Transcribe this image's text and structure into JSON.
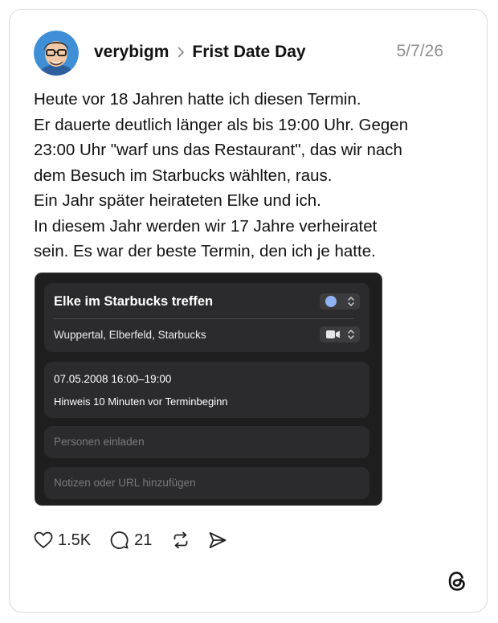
{
  "post": {
    "author": "verybigm",
    "topic": "Frist Date Day",
    "date": "5/7/26",
    "body_lines": [
      "Heute vor 18 Jahren hatte ich diesen Termin.",
      "Er dauerte deutlich länger als bis 19:00 Uhr. Gegen",
      "23:00 Uhr \"warf uns das Restaurant\", das wir nach",
      "dem Besuch im Starbucks wählten, raus.",
      "Ein Jahr später heirateten Elke und ich.",
      "In diesem Jahr werden wir 17 Jahre verheiratet",
      "sein. Es war der beste Termin, den ich je hatte."
    ]
  },
  "event": {
    "title": "Elke im Starbucks treffen",
    "location": "Wuppertal, Elberfeld, Starbucks",
    "datetime": "07.05.2008  16:00–19:00",
    "alert": "Hinweis 10 Minuten vor Terminbeginn",
    "invite_placeholder": "Personen einladen",
    "notes_placeholder": "Notizen oder URL hinzufügen",
    "calendar_color": "#8fb3f2"
  },
  "actions": {
    "likes": "1.5K",
    "replies": "21"
  },
  "icons": {
    "like": "heart-icon",
    "reply": "speech-bubble-icon",
    "repost": "repost-icon",
    "share": "send-icon",
    "brand": "threads-logo-icon"
  }
}
